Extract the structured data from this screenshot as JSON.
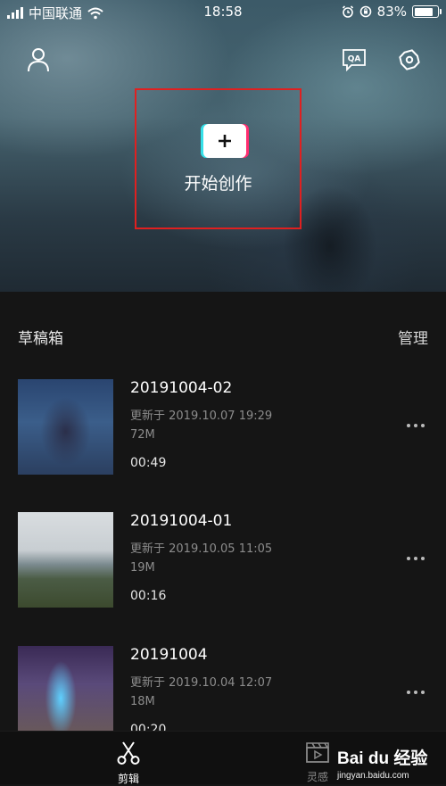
{
  "status_bar": {
    "carrier": "中国联通",
    "time": "18:58",
    "battery_percent": "83%",
    "battery_level": 0.83
  },
  "header": {
    "profile_icon": "user-icon",
    "qa_label": "QA",
    "settings_icon": "gear-icon"
  },
  "create": {
    "label": "开始创作",
    "accent_cyan": "#35e0e8",
    "accent_pink": "#ff2d6f",
    "highlight_color": "#e02020"
  },
  "drafts": {
    "title": "草稿箱",
    "manage_label": "管理",
    "items": [
      {
        "title": "20191004-02",
        "updated": "更新于 2019.10.07 19:29",
        "size": "72M",
        "duration": "00:49"
      },
      {
        "title": "20191004-01",
        "updated": "更新于 2019.10.05 11:05",
        "size": "19M",
        "duration": "00:16"
      },
      {
        "title": "20191004",
        "updated": "更新于 2019.10.04 12:07",
        "size": "18M",
        "duration": "00:20"
      }
    ]
  },
  "tabbar": {
    "tabs": [
      {
        "label": "剪辑",
        "icon": "scissors-icon",
        "active": true
      },
      {
        "label": "灵感",
        "icon": "clapperboard-icon",
        "active": false
      }
    ]
  },
  "watermark": {
    "logo": "Bai du 经验",
    "url": "jingyan.baidu.com"
  }
}
